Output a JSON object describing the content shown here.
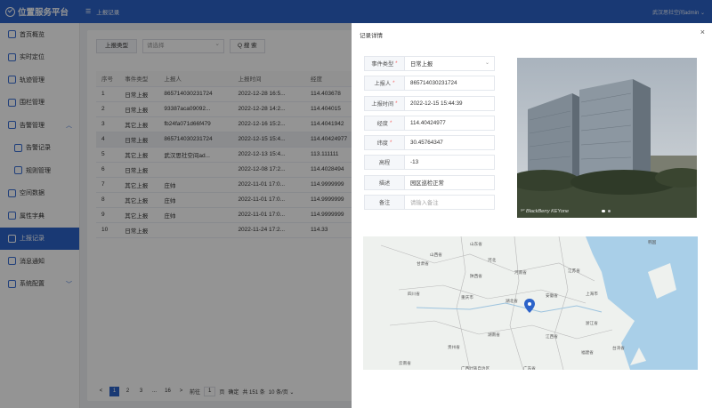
{
  "app": {
    "title": "位置服务平台",
    "breadcrumb": "上报记录",
    "user": "武汉思社空间admin ⌄"
  },
  "sidebar": {
    "items": [
      {
        "label": "首页概览",
        "icon": "home-icon"
      },
      {
        "label": "实时定位",
        "icon": "location-icon"
      },
      {
        "label": "轨迹管理",
        "icon": "route-icon"
      },
      {
        "label": "围栏管理",
        "icon": "fence-icon"
      },
      {
        "label": "告警管理",
        "icon": "alarm-icon"
      },
      {
        "label": "告警记录",
        "icon": "record-icon"
      },
      {
        "label": "规则管理",
        "icon": "rule-icon"
      },
      {
        "label": "空间数据",
        "icon": "database-icon"
      },
      {
        "label": "属性字典",
        "icon": "dictionary-icon"
      },
      {
        "label": "上报记录",
        "icon": "report-icon"
      },
      {
        "label": "消息通知",
        "icon": "message-icon"
      },
      {
        "label": "系统配置",
        "icon": "settings-icon"
      }
    ]
  },
  "filter": {
    "label": "上报类型",
    "select_placeholder": "请选择",
    "search_label": "Q 搜 索"
  },
  "table": {
    "headers": [
      "序号",
      "事件类型",
      "上报人",
      "上报时间",
      "经度"
    ],
    "rows": [
      [
        "1",
        "日常上报",
        "865714030231724",
        "2022-12-28 16:5...",
        "114.403678"
      ],
      [
        "2",
        "日常上报",
        "93387aca09092...",
        "2022-12-28 14:2...",
        "114.404015"
      ],
      [
        "3",
        "其它上报",
        "fb24fa071d66f479",
        "2022-12-16 15:2...",
        "114.4041942"
      ],
      [
        "4",
        "日常上报",
        "865714030231724",
        "2022-12-15 15:4...",
        "114.40424977"
      ],
      [
        "5",
        "其它上报",
        "武汉思社空间ad...",
        "2022-12-13 15:4...",
        "113.111111"
      ],
      [
        "6",
        "日常上报",
        "",
        "2022-12-08 17:2...",
        "114.4028494"
      ],
      [
        "7",
        "其它上报",
        "庄帅",
        "2022-11-01 17:0...",
        "114.9999999"
      ],
      [
        "8",
        "其它上报",
        "庄帅",
        "2022-11-01 17:0...",
        "114.9999999"
      ],
      [
        "9",
        "其它上报",
        "庄帅",
        "2022-11-01 17:0...",
        "114.9999999"
      ],
      [
        "10",
        "日常上报",
        "",
        "2022-11-24 17:2...",
        "114.33"
      ]
    ]
  },
  "pager": {
    "prev": "<",
    "pages": [
      "1",
      "2",
      "3",
      "...",
      "16"
    ],
    "next": ">",
    "goto_label": "前往",
    "goto_value": "1",
    "goto_suffix": "页",
    "confirm": "确定",
    "total": "共 151 条",
    "size": "10 条/页 ⌄"
  },
  "drawer": {
    "title": "记录详情",
    "close": "×",
    "fields": [
      {
        "label": "事件类型",
        "required": true,
        "value": "日常上报",
        "dropdown": true
      },
      {
        "label": "上报人",
        "required": true,
        "value": "865714030231724"
      },
      {
        "label": "上报时间",
        "required": true,
        "value": "2022-12-15 15:44:39"
      },
      {
        "label": "经度",
        "required": true,
        "value": "114.40424977"
      },
      {
        "label": "纬度",
        "required": true,
        "value": "30.45764347"
      },
      {
        "label": "高程",
        "required": false,
        "value": "-13"
      },
      {
        "label": "描述",
        "required": false,
        "value": "园区巡检正常"
      },
      {
        "label": "备注",
        "required": false,
        "value": "",
        "placeholder": "请输入备注"
      }
    ],
    "photo_caption": "⁵⁰ BlackBerry KEYone",
    "map_labels": [
      "山东省",
      "韩国",
      "山西省",
      "甘肃省",
      "河北",
      "陕西省",
      "河南省",
      "江苏省",
      "四川省",
      "重庆市",
      "湖北省",
      "上海市",
      "安徽省",
      "浙江省",
      "湖南省",
      "江西省",
      "贵州省",
      "福建省",
      "云南省",
      "广西壮族自治区",
      "广东省",
      "台湾省"
    ]
  }
}
